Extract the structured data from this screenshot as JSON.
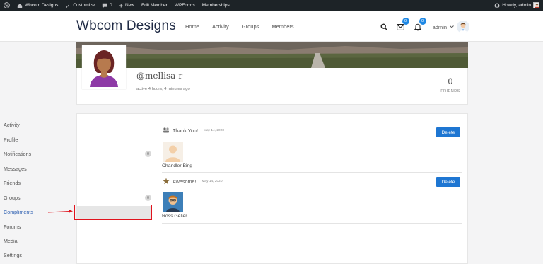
{
  "adminbar": {
    "site_name": "Wbcom Designs",
    "customize": "Customize",
    "comments_count": "0",
    "new": "New",
    "edit_member": "Edit Member",
    "wpforms": "WPForms",
    "memberships": "Memberships",
    "howdy": "Howdy, admin"
  },
  "header": {
    "site_title": "Wbcom Designs",
    "nav": [
      "Home",
      "Activity",
      "Groups",
      "Members"
    ],
    "messages_badge": "0",
    "notifications_badge": "0",
    "user_name": "admin"
  },
  "profile": {
    "handle": "@mellisa-r",
    "last_active": "active 4 hours, 4 minutes ago",
    "friends_count": "0",
    "friends_label": "FRIENDS"
  },
  "sidebar": {
    "items": [
      {
        "label": "Activity",
        "count": ""
      },
      {
        "label": "Profile",
        "count": ""
      },
      {
        "label": "Notifications",
        "count": "0"
      },
      {
        "label": "Messages",
        "count": ""
      },
      {
        "label": "Friends",
        "count": ""
      },
      {
        "label": "Groups",
        "count": "0"
      },
      {
        "label": "Compliments",
        "count": ""
      },
      {
        "label": "Forums",
        "count": ""
      },
      {
        "label": "Media",
        "count": ""
      },
      {
        "label": "Settings",
        "count": ""
      }
    ],
    "active": "Compliments"
  },
  "compliments": [
    {
      "title": "Thank You!",
      "date": "May 14, 2020",
      "sender": "Chandler Bing",
      "delete_label": "Delete"
    },
    {
      "title": "Awesome!",
      "date": "May 14, 2020",
      "sender": "Ross Geller",
      "delete_label": "Delete"
    }
  ],
  "colors": {
    "accent": "#1e76d2",
    "highlight": "#e0141e",
    "adminbar": "#1d2327"
  }
}
